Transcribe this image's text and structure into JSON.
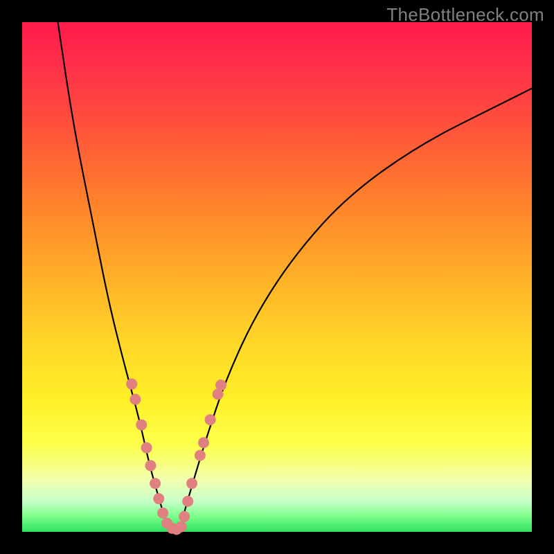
{
  "watermark": "TheBottleneck.com",
  "chart_data": {
    "type": "line",
    "title": "",
    "xlabel": "",
    "ylabel": "",
    "xlim": [
      0,
      100
    ],
    "ylim": [
      0,
      100
    ],
    "grid": false,
    "legend": false,
    "annotations": [],
    "series": [
      {
        "name": "left-branch",
        "x": [
          7,
          10,
          14,
          17,
          20,
          23,
          25,
          27,
          28.5
        ],
        "y": [
          100,
          80,
          60,
          45,
          33,
          22,
          13,
          6,
          1
        ],
        "color": "#000000"
      },
      {
        "name": "right-branch",
        "x": [
          31,
          33,
          36,
          40,
          46,
          54,
          64,
          78,
          94,
          100
        ],
        "y": [
          1,
          8,
          18,
          30,
          43,
          55,
          66,
          76,
          84,
          87
        ],
        "color": "#000000"
      }
    ],
    "beads": {
      "color": "#e08080",
      "radius_px": 8,
      "left": [
        {
          "x": 21.5,
          "y": 29
        },
        {
          "x": 22.2,
          "y": 26
        },
        {
          "x": 23.4,
          "y": 21
        },
        {
          "x": 24.4,
          "y": 16.5
        },
        {
          "x": 25.2,
          "y": 13
        },
        {
          "x": 26.1,
          "y": 9.5
        },
        {
          "x": 26.8,
          "y": 6.5
        },
        {
          "x": 27.6,
          "y": 3.7
        },
        {
          "x": 28.4,
          "y": 1.7
        },
        {
          "x": 29.4,
          "y": 0.7
        },
        {
          "x": 30.3,
          "y": 0.5
        }
      ],
      "right": [
        {
          "x": 31.2,
          "y": 1.0
        },
        {
          "x": 31.8,
          "y": 3.0
        },
        {
          "x": 32.5,
          "y": 6.0
        },
        {
          "x": 33.3,
          "y": 9.5
        },
        {
          "x": 34.9,
          "y": 15.0
        },
        {
          "x": 35.6,
          "y": 17.5
        },
        {
          "x": 36.9,
          "y": 22.0
        },
        {
          "x": 38.4,
          "y": 27.0
        },
        {
          "x": 39.0,
          "y": 28.8
        }
      ]
    }
  }
}
